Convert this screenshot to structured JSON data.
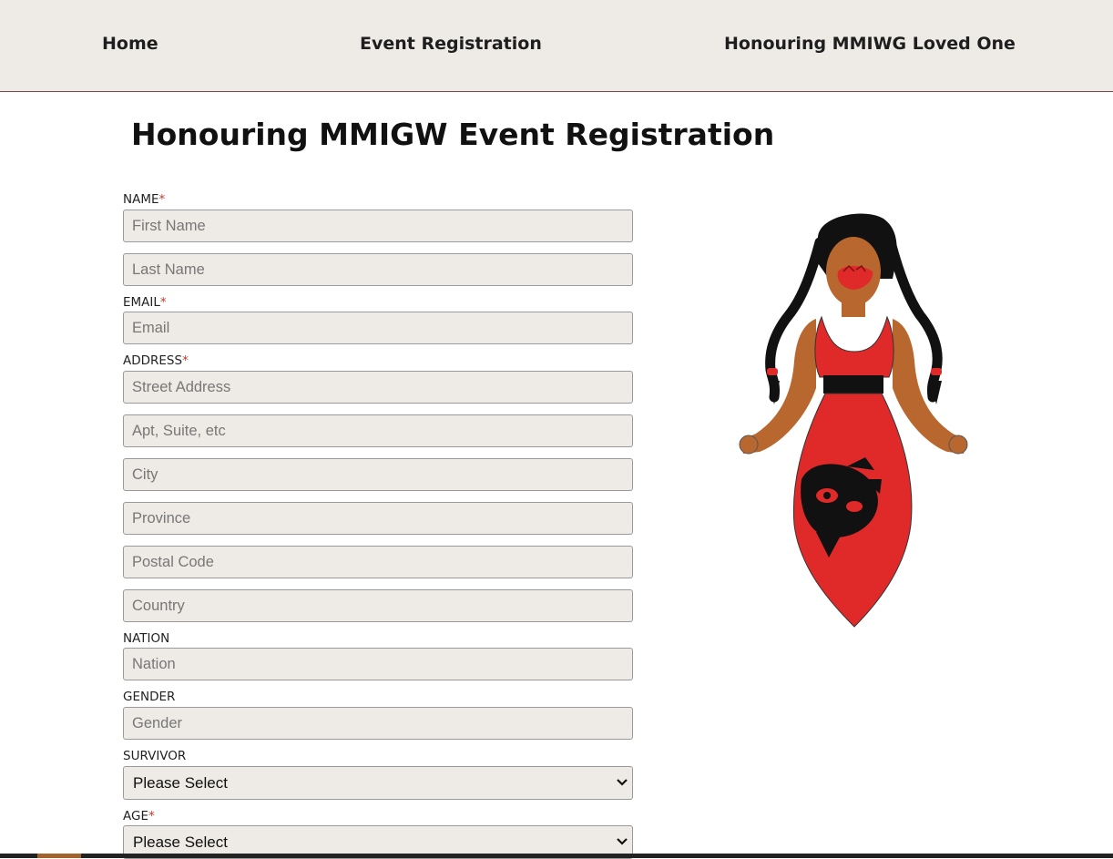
{
  "nav": {
    "items": [
      "Home",
      "Event Registration",
      "Honouring MMIWG Loved One"
    ]
  },
  "page_title": "Honouring MMIGW Event Registration",
  "form": {
    "name_label": "NAME",
    "first_name_placeholder": "First Name",
    "last_name_placeholder": "Last Name",
    "email_label": "EMAIL",
    "email_placeholder": "Email",
    "address_label": "ADDRESS",
    "street_placeholder": "Street Address",
    "apt_placeholder": "Apt, Suite, etc",
    "city_placeholder": "City",
    "province_placeholder": "Province",
    "postal_placeholder": "Postal Code",
    "country_placeholder": "Country",
    "nation_label": "NATION",
    "nation_placeholder": "Nation",
    "gender_label": "GENDER",
    "gender_placeholder": "Gender",
    "survivor_label": "SURVIVOR",
    "survivor_value": "Please Select",
    "age_label": "AGE",
    "age_value": "Please Select",
    "required_mark": "*"
  },
  "colors": {
    "nav_bg": "#eeebe7",
    "field_bg": "#eeebe7",
    "required": "#c0392b",
    "dress_red": "#e02a2a",
    "footer_accent": "#a4622d"
  },
  "illustration": {
    "icon": "red-dress-woman-illustration"
  }
}
